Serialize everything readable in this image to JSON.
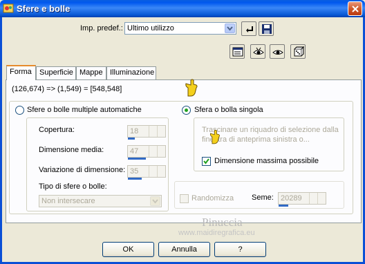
{
  "window": {
    "title": "Sfere e bolle"
  },
  "preset": {
    "label": "Imp. predef.:",
    "value": "Ultimo utilizzo"
  },
  "tabs": [
    "Forma",
    "Superficie",
    "Mappe",
    "Illuminazione"
  ],
  "coords": "(126,674) => (1,549) = [548,548]",
  "auto": {
    "radio_label": "Sfere o bolle multiple automatiche",
    "coverage_label": "Copertura:",
    "coverage_value": "18",
    "avg_size_label": "Dimensione media:",
    "avg_size_value": "47",
    "variation_label": "Variazione di dimensione:",
    "variation_value": "35",
    "type_label": "Tipo di sfere o bolle:",
    "type_value": "Non intersecare"
  },
  "single": {
    "radio_label": "Sfera o bolla singola",
    "hint": "Trascinare un riquadro di selezione dalla finestra di anteprima sinistra o...",
    "hint_line1": "Trascinare un riquadro di selezione dalla",
    "hint_line2": "finestra di anteprima sinistra o...",
    "max_size_label": "Dimensione massima possibile"
  },
  "randomize_label": "Randomizza",
  "seed_label": "Seme:",
  "seed_value": "20289",
  "buttons": {
    "ok": "OK",
    "cancel": "Annulla",
    "help": "?"
  },
  "watermark": {
    "name": "Pinuccia",
    "url": "www.maidiregrafica.eu"
  },
  "colors": {
    "titlebar": "#0058ee",
    "accent": "#e68b2c",
    "radio_dot": "#21a121"
  }
}
